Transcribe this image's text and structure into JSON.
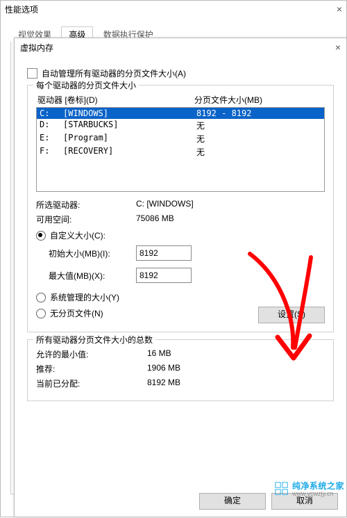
{
  "perf": {
    "title": "性能选项",
    "tabs": {
      "visual": "视觉效果",
      "advanced": "高级",
      "dep": "数据执行保护"
    },
    "buttons": {
      "ok": "确定",
      "cancel": "取消"
    }
  },
  "vm": {
    "title": "虚拟内存",
    "auto_manage": "自动管理所有驱动器的分页文件大小(A)",
    "group_drives_label": "每个驱动器的分页文件大小",
    "col_drive": "驱动器 [卷标](D)",
    "col_pagefile": "分页文件大小(MB)",
    "drives": [
      {
        "d": "C:",
        "vol": "[WINDOWS]",
        "pf": "8192 - 8192",
        "sel": true
      },
      {
        "d": "D:",
        "vol": "[STARBUCKS]",
        "pf": "无",
        "sel": false
      },
      {
        "d": "E:",
        "vol": "[Program]",
        "pf": "无",
        "sel": false
      },
      {
        "d": "F:",
        "vol": "[RECOVERY]",
        "pf": "无",
        "sel": false
      }
    ],
    "selected_drive_label": "所选驱动器:",
    "selected_drive_value": "C:  [WINDOWS]",
    "free_space_label": "可用空间:",
    "free_space_value": "75086 MB",
    "radio_custom": "自定义大小(C):",
    "initial_label": "初始大小(MB)(I):",
    "initial_value": "8192",
    "max_label": "最大值(MB)(X):",
    "max_value": "8192",
    "radio_system": "系统管理的大小(Y)",
    "radio_none": "无分页文件(N)",
    "set_button": "设置(S)",
    "group_total_label": "所有驱动器分页文件大小的总数",
    "min_label": "允许的最小值:",
    "min_value": "16 MB",
    "rec_label": "推荐:",
    "rec_value": "1906 MB",
    "cur_label": "当前已分配:",
    "cur_value": "8192 MB",
    "ok": "确定",
    "cancel": "取消"
  },
  "watermark": {
    "brand": "纯净系统之家",
    "url": "www.ycwzjy.cn"
  }
}
